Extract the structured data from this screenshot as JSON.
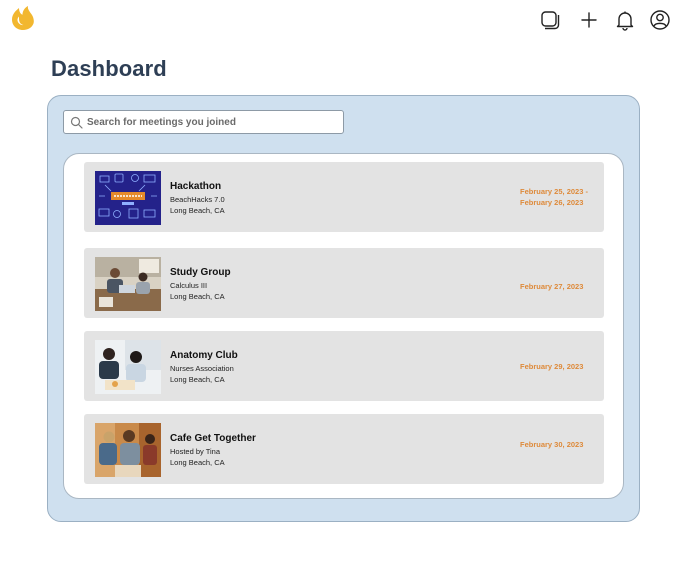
{
  "header": {
    "icons": [
      "logo-flame-icon",
      "square-stack-icon",
      "plus-icon",
      "bell-icon",
      "user-circle-icon"
    ]
  },
  "page": {
    "title": "Dashboard"
  },
  "search": {
    "placeholder": "Search for meetings you joined",
    "value": ""
  },
  "meetings": [
    {
      "title": "Hackathon",
      "subtitle": "BeachHacks 7.0",
      "location": "Long Beach, CA",
      "date_line1": "February 25, 2023 -",
      "date_line2": "February 26, 2023",
      "image": "hackathon-banner"
    },
    {
      "title": "Study Group",
      "subtitle": "Calculus III",
      "location": "Long Beach, CA",
      "date_line1": "February 27, 2023",
      "date_line2": "",
      "image": "study-group-photo"
    },
    {
      "title": "Anatomy Club",
      "subtitle": "Nurses Association",
      "location": "Long Beach, CA",
      "date_line1": "February 29, 2023",
      "date_line2": "",
      "image": "anatomy-club-photo"
    },
    {
      "title": "Cafe Get Together",
      "subtitle": "Hosted by Tina",
      "location": "Long Beach, CA",
      "date_line1": "February 30, 2023",
      "date_line2": "",
      "image": "cafe-photo"
    }
  ],
  "colors": {
    "accent": "#de8a3a",
    "panel": "#cfe0ef",
    "title": "#2e3f55",
    "logo": "#f2b72f"
  }
}
